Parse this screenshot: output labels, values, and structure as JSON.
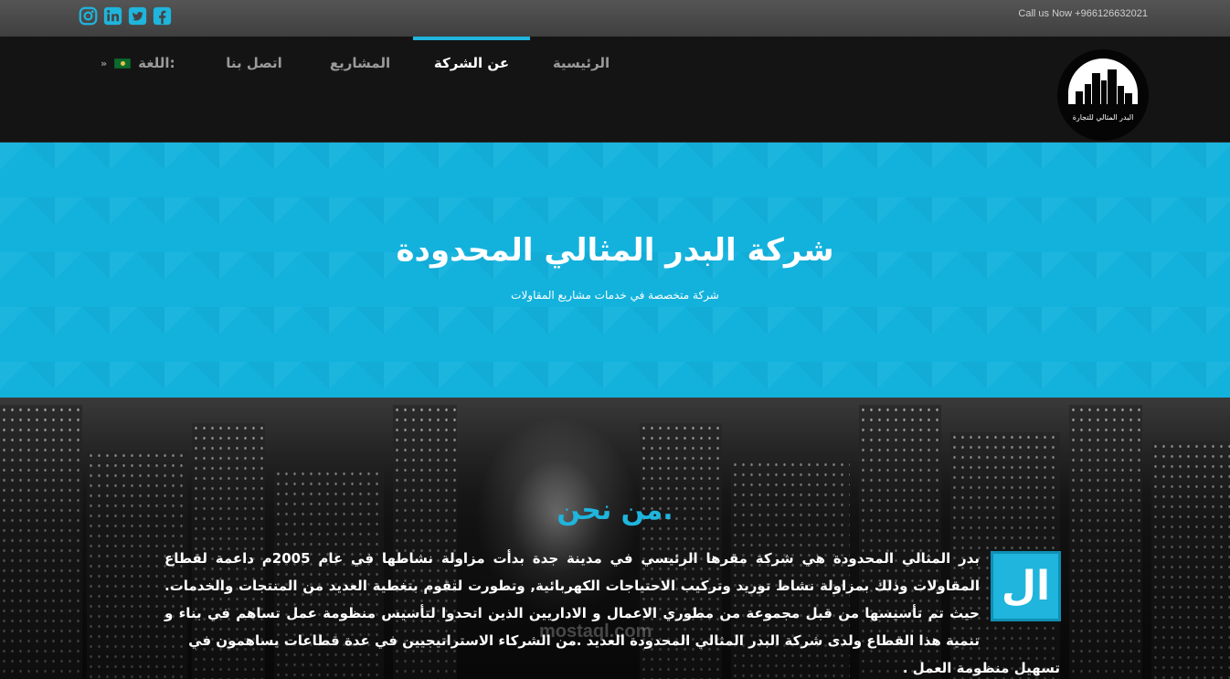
{
  "topbar": {
    "call_text": "Call us Now +966126632021",
    "social": [
      {
        "icon": "instagram-icon"
      },
      {
        "icon": "linkedin-icon"
      },
      {
        "icon": "twitter-icon"
      },
      {
        "icon": "facebook-icon"
      }
    ]
  },
  "nav": {
    "items": [
      {
        "label": "الرئيسية",
        "active": false
      },
      {
        "label": "عن الشركة",
        "active": true
      },
      {
        "label": "المشاريع",
        "active": false
      },
      {
        "label": "اتصل بنا",
        "active": false
      }
    ],
    "language_label": "اللغة:",
    "language_flag": "saudi-flag-icon"
  },
  "logo": {
    "text": "البدر المثالي للتجارة"
  },
  "hero": {
    "title": "شركة البدر المثالي المحدودة",
    "subtitle": "شركة متخصصة في خدمات مشاريع المقاولات"
  },
  "about": {
    "title": "من نحن.",
    "dropcap": "ال",
    "paragraph": "بدر المثالي المحدودة هي شركة مقرها الرئيسي في مدينة جدة بدأت مزاولة نشاطها في عام 2005م داعمة لقطاع المقاولات وذلك بمزاولة نشاط توريد وتركيب الاحتياجات الكهربائية, وتطورت لتقوم بتغطية العديد من المنتجات والخدمات. حيث تم تأسيسها من قبل مجموعة من مطوري الاعمال و الاداريين الذين اتحدوا لتأسيس منظومة عمل تساهم في بناء و تنمية هذا القطاع ولدى شركة البدر المثالي المحدودة العديد .من الشركاء الاستراتيجيين في عدة قطاعات يساهمون في",
    "last_line": "تسهيل منظومة العمل ."
  },
  "watermark": "mostaql.com",
  "colors": {
    "accent": "#1fb5dd",
    "nav_bg": "#141414",
    "topbar_bg": "#444444"
  }
}
